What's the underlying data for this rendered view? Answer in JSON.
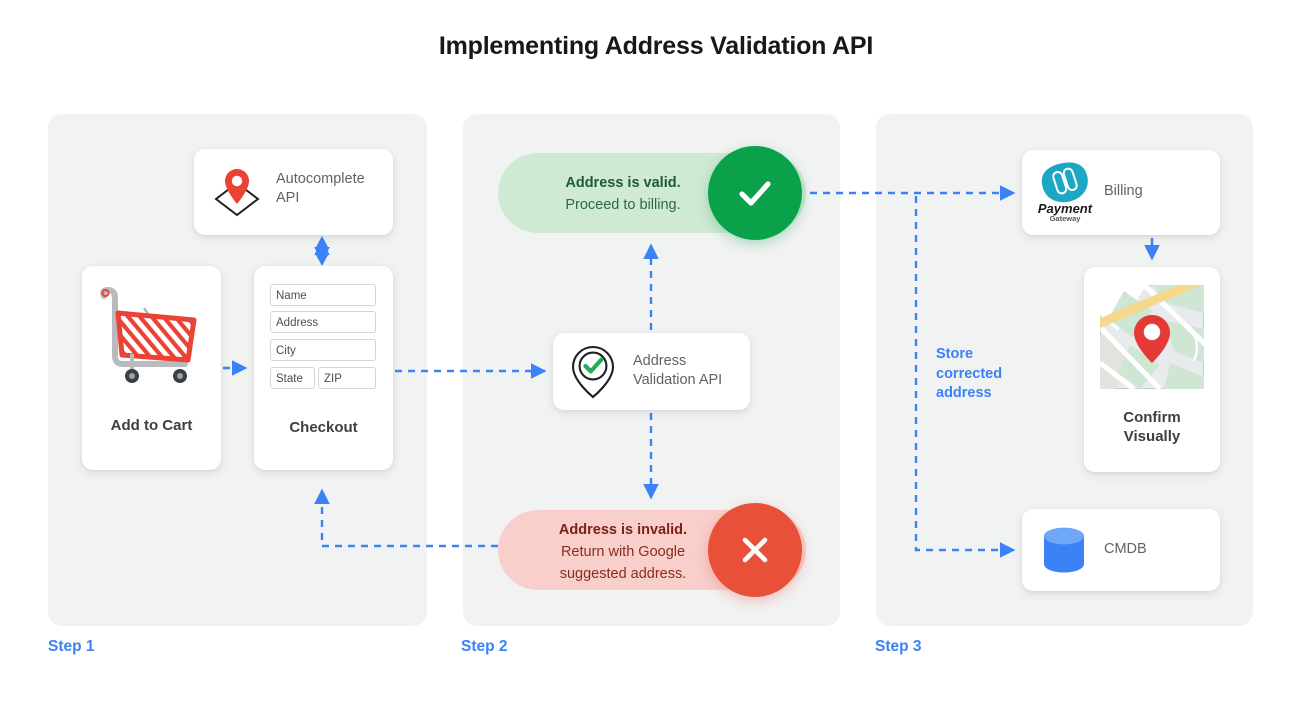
{
  "title": "Implementing Address Validation API",
  "accent": {
    "blue": "#3b82f6",
    "green": "#0ba04a",
    "red": "#e8503a",
    "panel": "#f1f2f2"
  },
  "steps": [
    {
      "label": "Step 1"
    },
    {
      "label": "Step 2"
    },
    {
      "label": "Step 3"
    }
  ],
  "step1": {
    "autocomplete": {
      "label": "Autocomplete\nAPI",
      "label_line1": "Autocomplete",
      "label_line2": "API",
      "icon": "map-pin-diamond-icon"
    },
    "add_to_cart": {
      "label": "Add to Cart",
      "icon": "shopping-cart-icon"
    },
    "checkout": {
      "label": "Checkout",
      "fields": [
        {
          "name": "name-field",
          "placeholder": "Name"
        },
        {
          "name": "address-field",
          "placeholder": "Address"
        },
        {
          "name": "city-field",
          "placeholder": "City"
        },
        {
          "name": "state-field",
          "placeholder": "State"
        },
        {
          "name": "zip-field",
          "placeholder": "ZIP"
        }
      ]
    }
  },
  "step2": {
    "valid": {
      "line1": "Address is valid.",
      "line2": "Proceed to billing.",
      "icon": "check-circle-icon"
    },
    "validation_api": {
      "label_line1": "Address",
      "label_line2": "Validation API",
      "icon": "map-pin-check-icon"
    },
    "invalid": {
      "line1": "Address is invalid.",
      "line2": "Return with Google",
      "line3": "suggested address.",
      "icon": "x-circle-icon"
    }
  },
  "step3": {
    "billing": {
      "label": "Billing",
      "logo_line1": "Payment",
      "logo_line2": "Gateway",
      "icon": "payment-gateway-icon"
    },
    "confirm": {
      "label_line1": "Confirm",
      "label_line2": "Visually",
      "icon": "map-thumbnail-icon"
    },
    "cmdb": {
      "label": "CMDB",
      "icon": "database-cylinder-icon"
    },
    "store_note": {
      "line1": "Store",
      "line2": "corrected",
      "line3": "address"
    }
  }
}
